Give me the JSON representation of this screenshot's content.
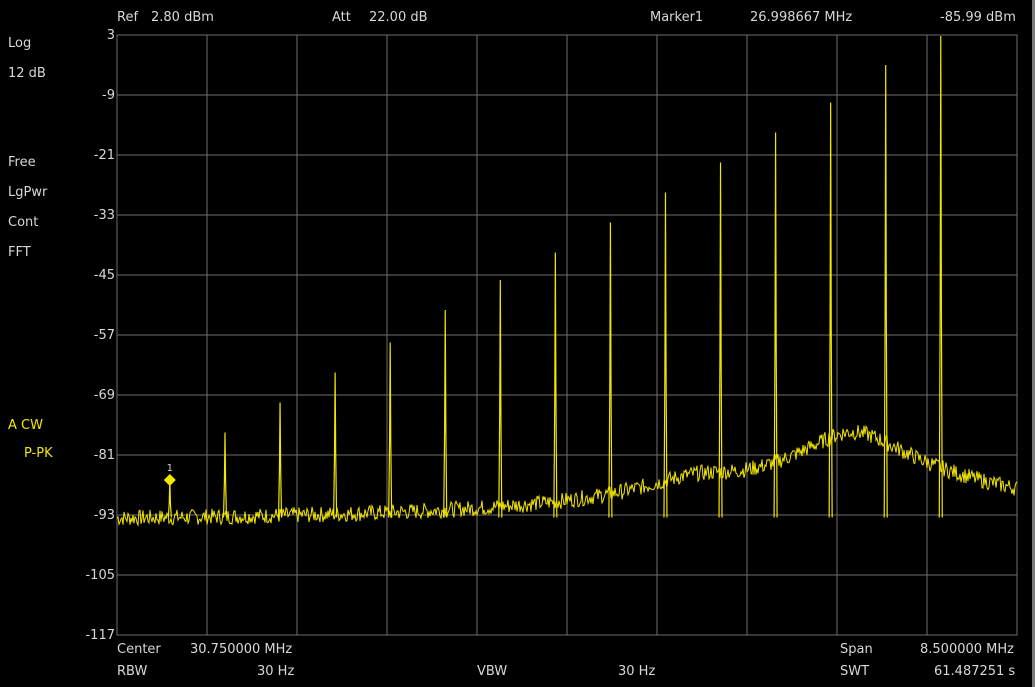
{
  "header": {
    "ref_label": "Ref",
    "ref_value": "2.80 dBm",
    "att_label": "Att",
    "att_value": "22.00 dB",
    "marker_label": "Marker1",
    "marker_freq": "26.998667 MHz",
    "marker_level": "-85.99 dBm"
  },
  "left_panel": {
    "scale_type": "Log",
    "scale_div": "12 dB",
    "trig": "Free",
    "avg_type": "LgPwr",
    "sweep_mode": "Cont",
    "sweep_type": "FFT",
    "trace_mode": "A CW",
    "detector": "P-PK"
  },
  "footer": {
    "center_label": "Center",
    "center_value": "30.750000 MHz",
    "rbw_label": "RBW",
    "rbw_value": "30 Hz",
    "vbw_label": "VBW",
    "vbw_value": "30 Hz",
    "span_label": "Span",
    "span_value": "8.500000 MHz",
    "swt_label": "SWT",
    "swt_value": "61.487251 s"
  },
  "chart_data": {
    "type": "line",
    "trace_color": "#f2e600",
    "grid_color": "#6e6e6e",
    "y_ticks": [
      "3",
      "-9",
      "-21",
      "-33",
      "-45",
      "-57",
      "-69",
      "-81",
      "-93",
      "-105",
      "-117"
    ],
    "ylim": [
      -117,
      3
    ],
    "xlim": [
      26.5,
      35.0
    ],
    "x_divisions": 10,
    "grid": true,
    "noise_floor_dbm": -94.5,
    "noise_hump": [
      {
        "x": 33.45,
        "level": -76.5,
        "width": 0.78
      },
      {
        "x": 32.0,
        "level": -88.0,
        "width": 0.9
      }
    ],
    "peaks": [
      {
        "x": 26.999,
        "y": -86.0
      },
      {
        "x": 27.52,
        "y": -76.5
      },
      {
        "x": 28.04,
        "y": -70.5
      },
      {
        "x": 28.56,
        "y": -64.5
      },
      {
        "x": 29.08,
        "y": -58.5
      },
      {
        "x": 29.6,
        "y": -52.0
      },
      {
        "x": 30.12,
        "y": -46.0
      },
      {
        "x": 30.64,
        "y": -40.5
      },
      {
        "x": 31.16,
        "y": -34.5
      },
      {
        "x": 31.68,
        "y": -28.5
      },
      {
        "x": 32.2,
        "y": -22.5
      },
      {
        "x": 32.72,
        "y": -16.5
      },
      {
        "x": 33.24,
        "y": -10.5
      },
      {
        "x": 33.76,
        "y": -3.0
      },
      {
        "x": 34.28,
        "y": 2.8
      }
    ],
    "marker": {
      "label": "1",
      "x": 26.998667,
      "y": -85.99
    }
  }
}
